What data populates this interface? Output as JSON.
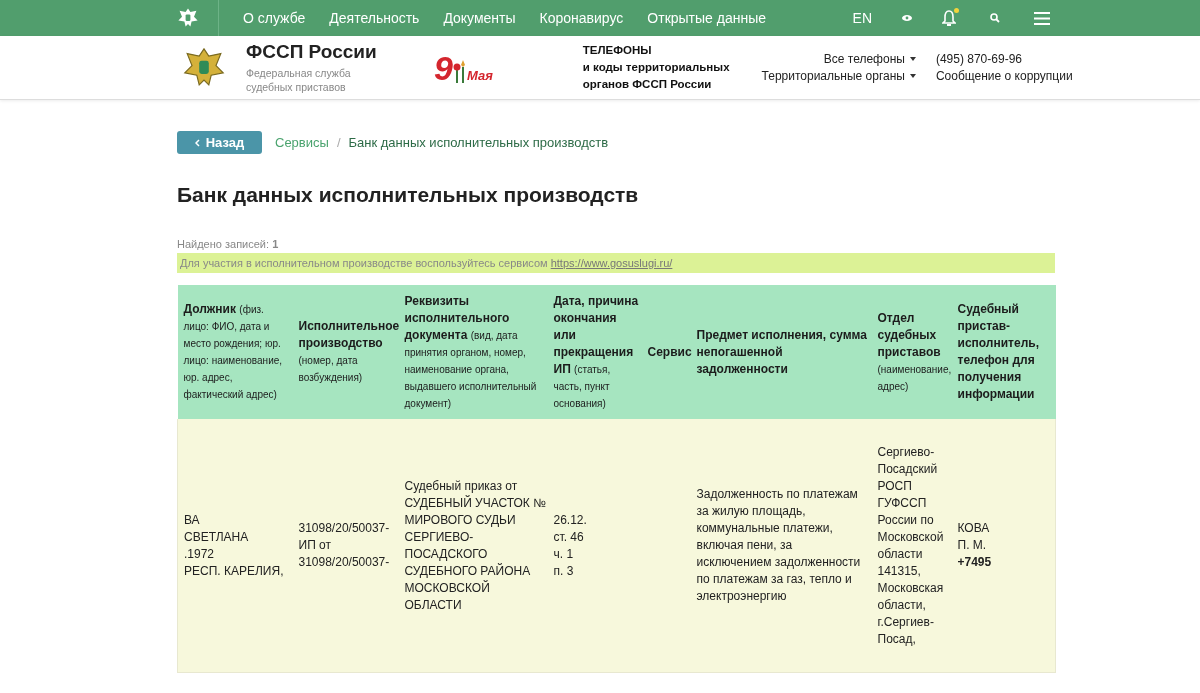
{
  "top_nav": {
    "items": [
      "О службе",
      "Деятельность",
      "Документы",
      "Коронавирус",
      "Открытые данные"
    ],
    "language": "EN",
    "notification_dot": true
  },
  "header": {
    "title": "ФССП России",
    "subtitle": "Федеральная служба судебных приставов",
    "promo": {
      "number": "9",
      "word": "Мая"
    },
    "phones_block": [
      "ТЕЛЕФОНЫ",
      "и коды территориальных",
      "органов ФССП России"
    ],
    "dropdowns": [
      "Все телефоны",
      "Территориальные органы"
    ],
    "phone": "(495) 870-69-96",
    "corruption_link": "Сообщение о коррупции"
  },
  "back_button": "Назад",
  "breadcrumb_separator": "/",
  "breadcrumbs": [
    {
      "label": "Сервисы",
      "link": true
    },
    {
      "label": "Банк данных исполнительных производств",
      "link": false
    }
  ],
  "page_title": "Банк данных исполнительных производств",
  "found": {
    "label": "Найдено записей:",
    "count": "1"
  },
  "notice": {
    "text": "Для участия в исполнительном производстве воспользуйтесь сервисом",
    "link": "https://www.gosuslugi.ru/"
  },
  "table": {
    "columns": [
      {
        "title": "Должник",
        "note": "(физ. лицо: ФИО, дата и место рождения; юр. лицо: наименование, юр. адрес, фактический адрес)"
      },
      {
        "title": "Исполнительное производство",
        "note": "(номер, дата возбуждения)"
      },
      {
        "title": "Реквизиты исполнительного документа",
        "note": "(вид, дата принятия органом, номер, наименование органа, выдавшего исполнительный документ)"
      },
      {
        "title": "Дата, причина окончания или прекращения ИП",
        "note": "(статья, часть, пункт основания)"
      },
      {
        "title": "Сервис"
      },
      {
        "title": "Предмет исполнения, сумма непогашенной задолженности"
      },
      {
        "title": "Отдел судебных приставов",
        "note": "(наименование, адрес)"
      },
      {
        "title": "Судебный пристав-исполнитель, телефон для получения информации"
      }
    ],
    "rows": [
      {
        "cells": [
          {
            "lines": [
              "ВА",
              "СВЕТЛАНА",
              ".1972",
              "РЕСП. КАРЕЛИЯ,"
            ]
          },
          {
            "lines": [
              "31098/20/50037-",
              "ИП от",
              "31098/20/50037-"
            ]
          },
          {
            "lines": [
              "Судебный приказ от",
              "СУДЕБНЫЙ УЧАСТОК №",
              "МИРОВОГО СУДЬИ",
              "СЕРГИЕВО-",
              "ПОСАДСКОГО",
              "СУДЕБНОГО РАЙОНА",
              "МОСКОВСКОЙ",
              "ОБЛАСТИ"
            ]
          },
          {
            "lines": [
              "26.12.",
              "ст. 46",
              "ч. 1",
              "п. 3"
            ]
          },
          {},
          {
            "lines": [
              "Задолженность по платежам за жилую площадь, коммунальные платежи, включая пени, за исключением задолженности по платежам за газ, тепло и электроэнергию"
            ]
          },
          {
            "lines": [
              "Сергиево-",
              "Посадский",
              "РОСП",
              "ГУФССП",
              "России по",
              "Московской",
              "области",
              "141315,",
              "Московская",
              "области,",
              "г.Сергиев-",
              "Посад,"
            ]
          },
          {
            "lines": [
              "КОВА",
              "П. М."
            ],
            "phone": "+7495"
          }
        ]
      }
    ]
  }
}
